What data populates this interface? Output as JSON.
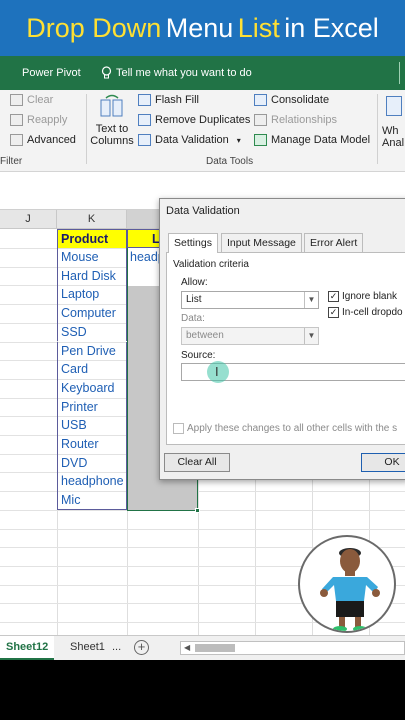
{
  "banner": {
    "part1": "Drop Down",
    "part2": "Menu",
    "part3": "List",
    "part4": "in Excel"
  },
  "menubar": {
    "power_pivot": "Power Pivot",
    "tell_me": "Tell me what you want to do"
  },
  "ribbon": {
    "filter": {
      "clear": "Clear",
      "reapply": "Reapply",
      "advanced": "Advanced",
      "group_label": "Filter"
    },
    "data_tools": {
      "text_to_columns_line1": "Text to",
      "text_to_columns_line2": "Columns",
      "flash_fill": "Flash Fill",
      "remove_duplicates": "Remove Duplicates",
      "data_validation": "Data Validation",
      "consolidate": "Consolidate",
      "relationships": "Relationships",
      "manage_data_model": "Manage Data Model",
      "group_label": "Data Tools"
    },
    "whatif_line1": "Wh",
    "whatif_line2": "Anal"
  },
  "columns": {
    "j": "J",
    "k": "K"
  },
  "sheet": {
    "k_header": "Product",
    "l_header": "L",
    "l_value": "headphone",
    "products": [
      "Mouse",
      "Hard Disk",
      "Laptop",
      "Computer",
      "SSD",
      "Pen Drive",
      "Card",
      "Keyboard",
      "Printer",
      "USB",
      "Router",
      "DVD",
      "headphone",
      "Mic"
    ]
  },
  "dialog": {
    "title": "Data Validation",
    "tabs": [
      "Settings",
      "Input Message",
      "Error Alert"
    ],
    "validation_criteria": "Validation criteria",
    "allow_label": "Allow:",
    "allow_value": "List",
    "ignore_blank": "Ignore blank",
    "in_cell_dropdown": "In-cell dropdo",
    "data_label": "Data:",
    "data_value": "between",
    "source_label": "Source:",
    "apply_all": "Apply these changes to all other cells with the s",
    "clear_all": "Clear All",
    "ok": "OK"
  },
  "tabbar": {
    "sheet12": "Sheet12",
    "sheet1": "Sheet1",
    "ellipsis": "...",
    "plus": "+"
  },
  "colors": {
    "excel_green": "#217346",
    "banner_blue": "#1e72bd",
    "header_yellow": "#ffff00"
  }
}
